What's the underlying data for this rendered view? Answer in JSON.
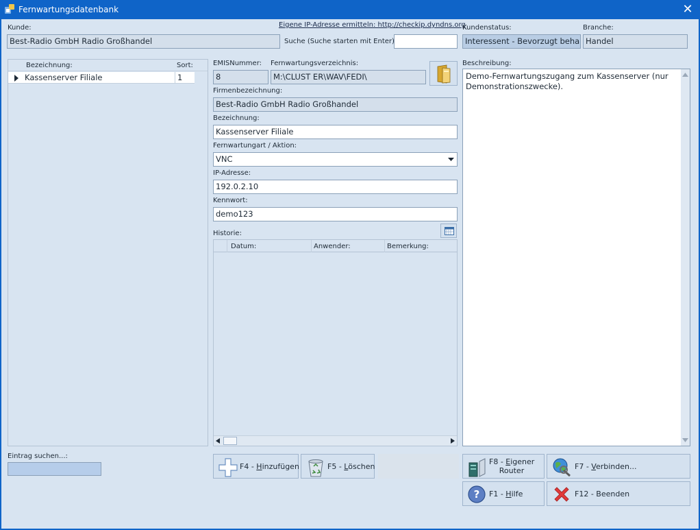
{
  "window": {
    "title": "Fernwartungsdatenbank",
    "close_icon": "close-icon"
  },
  "customer": {
    "label": "Kunde:",
    "value": "Best-Radio GmbH Radio Großhandel",
    "ip_link": "Eigene IP-Adresse ermitteln: http://checkip.dyndns.org",
    "search_label": "Suche (Suche starten mit Enter):",
    "search_value": "",
    "status_label": "Kundenstatus:",
    "status_value": "Interessent - Bevorzugt behandeln",
    "branch_label": "Branche:",
    "branch_value": "Handel"
  },
  "entry_list": {
    "col_name": "Bezeichnung:",
    "col_sort": "Sort:",
    "rows": [
      {
        "name": "Kassenserver Filiale",
        "sort": "1"
      }
    ],
    "search_label": "Eintrag suchen...:",
    "search_value": ""
  },
  "detail": {
    "emis_label": "EMISNummer:",
    "emis_value": "8",
    "dir_label": "Fernwartungsverzeichnis:",
    "dir_value": "M:\\CLUST ER\\WAV\\FEDI\\",
    "company_label": "Firmenbezeichnung:",
    "company_value": "Best-Radio GmbH Radio Großhandel",
    "name_label": "Bezeichnung:",
    "name_value": "Kassenserver Filiale",
    "type_label": "Fernwartungart / Aktion:",
    "type_value": "VNC",
    "ip_label": "IP-Adresse:",
    "ip_value": "192.0.2.10",
    "pw_label": "Kennwort:",
    "pw_value": "demo123",
    "history_label": "Historie:",
    "history_cols": [
      "Datum:",
      "Anwender:",
      "Bemerkung:"
    ]
  },
  "description": {
    "label": "Beschreibung:",
    "text": "Demo-Fernwartungszugang zum Kassenserver (nur Demonstrationszwecke)."
  },
  "buttons": {
    "add": {
      "key": "F4 - ",
      "accel": "H",
      "rest": "inzufügen"
    },
    "delete": {
      "key": "F5 - ",
      "accel": "L",
      "rest": "öschen"
    },
    "router": {
      "key": "F8 - ",
      "accel": "E",
      "rest": "igener",
      "line2": "Router"
    },
    "connect": {
      "key": "F7 - ",
      "accel": "V",
      "rest": "erbinden..."
    },
    "help": {
      "key": "F1 - ",
      "accel": "H",
      "rest": "ilfe"
    },
    "quit": {
      "key": "F12 - Beenden"
    }
  }
}
